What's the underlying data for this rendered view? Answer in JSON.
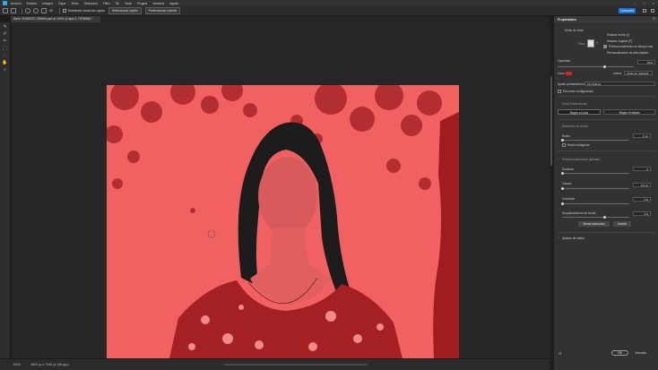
{
  "menubar": {
    "items": [
      "Archivo",
      "Edición",
      "Imagen",
      "Capa",
      "Texto",
      "Selección",
      "Filtro",
      "3D",
      "Vista",
      "Plugins",
      "Ventana",
      "Ayuda"
    ],
    "window_controls": [
      "–",
      "□",
      "×"
    ]
  },
  "options": {
    "brush_size": "30",
    "show_edges_label": "Muestrear todas las capas",
    "select_subject": "Seleccionar sujeto",
    "refine_hair": "Perfeccionar cabello",
    "share": "Compartir"
  },
  "document": {
    "tab_title": "Ejem 11062022 1356ith.psd al 100% (Capa 2, RGB/8#) *"
  },
  "status": {
    "zoom": "100%",
    "doc_info": "4629 px x 7448 px (96 ppp)"
  },
  "panel": {
    "title": "Propiedades",
    "view_mode_label": "Modo de vista",
    "view_label": "Vista:",
    "show_edge": "Mostrar borde (J)",
    "show_original": "Mostrar original (P)",
    "real_time": "Perfeccionamiento en tiempo real",
    "hq_preview": "Previsualización de alta calidad",
    "transparency_label": "Opacidad",
    "transparency_value": "50%",
    "color_label": "Color",
    "indicates_label": "Indica:",
    "indicates_value": "Áreas de máscara",
    "preset_label": "Ajuste preestablecido:",
    "preset_value": "Por defecto",
    "remember_settings": "Recordar configuración",
    "refine_mode_label": "Modo Perfeccionar",
    "mode_color": "Según el color",
    "mode_object": "Según el objeto",
    "edge_detection_label": "Detección de borde",
    "radius_label": "Radio",
    "radius_value": "0 px",
    "smart_radius": "Radio inteligente",
    "global_refinements_label": "Perfeccionamientos globales",
    "smooth_label": "Suavizar",
    "smooth_value": "0",
    "feather_label": "Calado",
    "feather_value": "0,0 px",
    "contrast_label": "Contraste",
    "contrast_value": "0%",
    "shift_edge_label": "Desplazamiento de borde",
    "shift_edge_value": "0%",
    "clear_selection": "Borrar selección",
    "invert": "Invertir",
    "output_settings": "Ajustes de salida",
    "ok": "OK",
    "cancel": "Cancelar"
  },
  "colors": {
    "overlay": "#f26161",
    "overlay_dark": "#9f1d1f",
    "accent": "#1473e6",
    "color_swatch": "#e02020"
  }
}
